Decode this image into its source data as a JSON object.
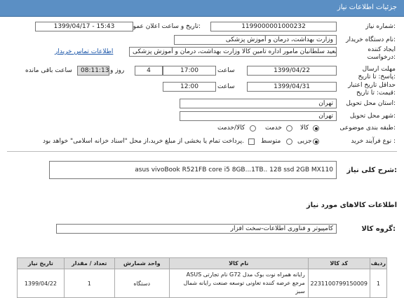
{
  "header": {
    "title": "جزئیات اطلاعات نیاز"
  },
  "need_number": {
    "label": "شماره نیاز:",
    "value": "1199000001000232"
  },
  "announce": {
    "label": "تاریخ و ساعت اعلان عمومی:",
    "value": "1399/04/17 - 15:43"
  },
  "buyer": {
    "label": "نام دستگاه خریدار:",
    "value": "وزارت بهداشت، درمان و آموزش پزشکی"
  },
  "creator": {
    "label": "ایجاد کننده درخواست:",
    "value": "سعید سلطانیان مامور اداره تامین کالا وزارت بهداشت، درمان و آموزش پزشکی",
    "contact_link": "اطلاعات تماس خریدار"
  },
  "reply_deadline": {
    "label": "مهلت ارسال پاسخ: تا تاریخ:",
    "date": "1399/04/22",
    "time_label": "ساعت",
    "time": "17:00",
    "days": "4",
    "days_label": "روز و",
    "remaining": "08:11:13",
    "remaining_label": "ساعت باقی مانده"
  },
  "price_validity": {
    "label": "حداقل تاریخ اعتبار قیمت: تا تاریخ:",
    "date": "1399/04/31",
    "time_label": "ساعت",
    "time": "12:00"
  },
  "province": {
    "label": "استان محل تحویل:",
    "value": "تهران"
  },
  "city": {
    "label": "شهر محل تحویل:",
    "value": "تهران"
  },
  "category": {
    "label": "طبقه بندی موضوعی:",
    "options": [
      "کالا",
      "خدمت",
      "کالا/خدمت"
    ]
  },
  "process": {
    "label": "نوع فرآیند خرید :",
    "options": [
      "جزیی",
      "متوسط"
    ],
    "note": "پرداخت تمام یا بخشی از مبلغ خرید،از محل \"اسناد خزانه اسلامی\" خواهد بود."
  },
  "general_desc": {
    "label": "شرح کلی نیاز:",
    "value": "asus vivoBook R521FB core i5 8GB...1TB.. 128 ssd 2GB MX110"
  },
  "goods_info": {
    "title": "اطلاعات کالاهای مورد نیاز"
  },
  "goods_group": {
    "label": "گروه کالا:",
    "value": "کامپیوتر و فناوری اطلاعات-سخت افزار"
  },
  "table": {
    "headers": [
      "ردیف",
      "کد کالا",
      "نام کالا",
      "واحد شمارش",
      "تعداد / مقدار",
      "تاریخ نیاز"
    ],
    "rows": [
      {
        "row": "1",
        "code": "2231100799150009",
        "name": "رایانه همراه نوت بوک مدل G72 نام تجارتی ASUS مرجع عرضه کننده تعاونی توسعه صنعت رایانه شمال سبز",
        "unit": "دستگاه",
        "qty": "1",
        "date": "1399/04/22"
      }
    ]
  }
}
